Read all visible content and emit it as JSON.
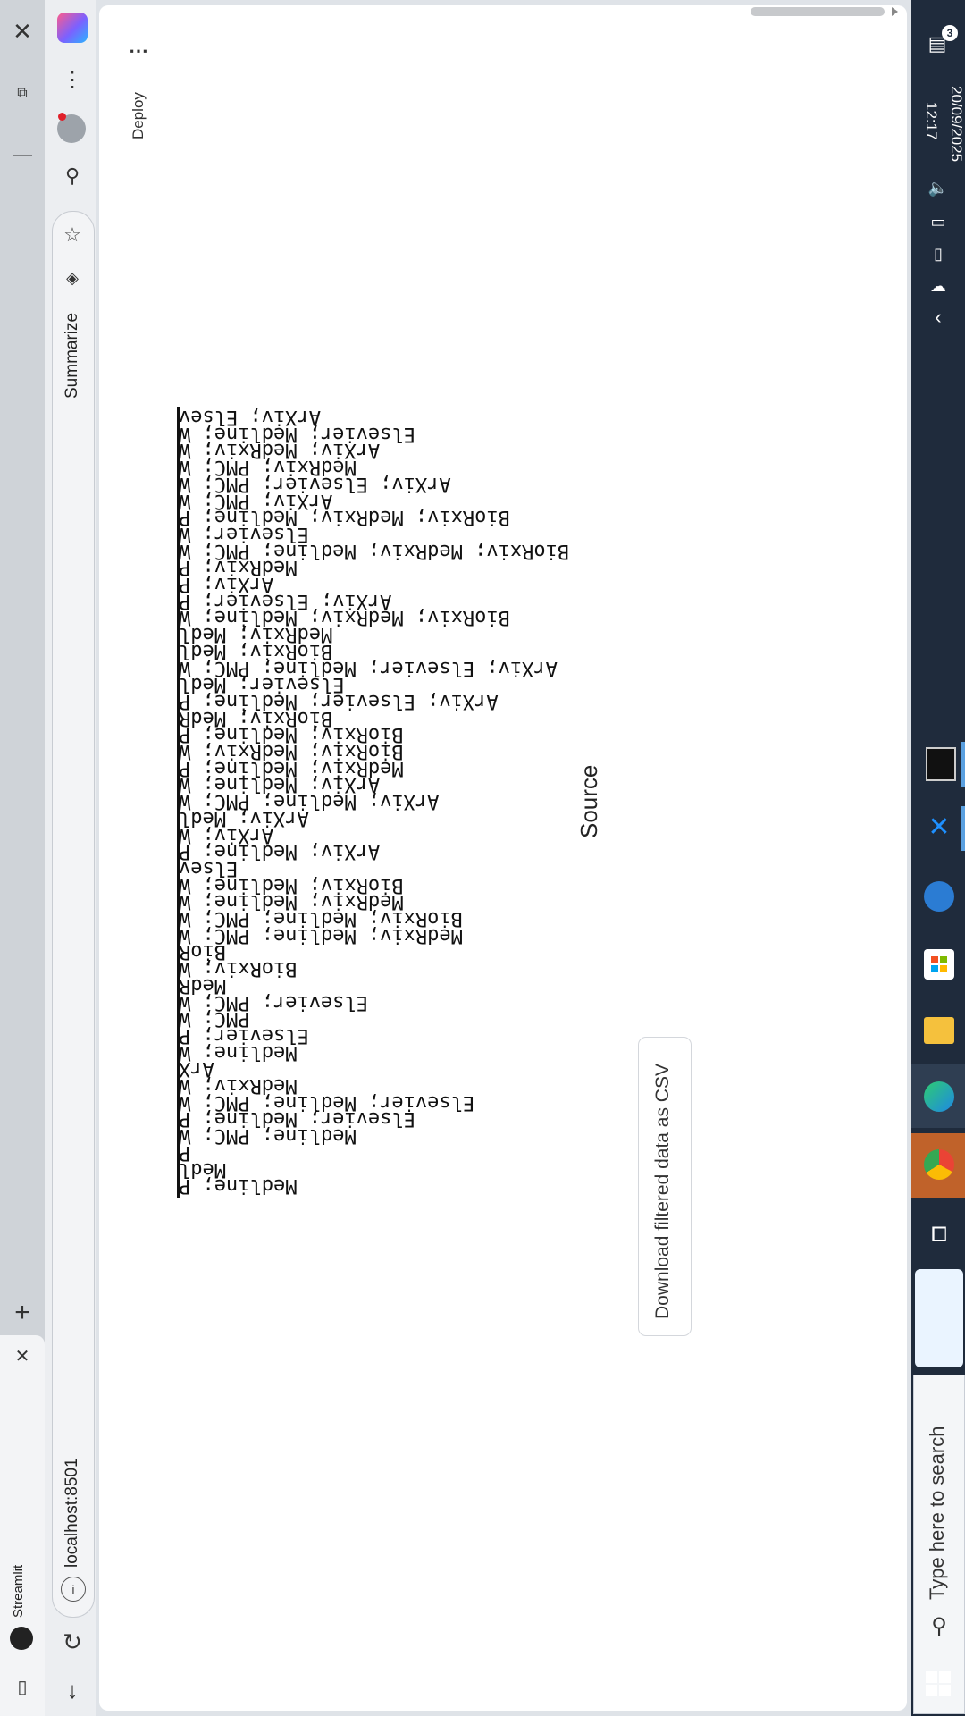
{
  "browser": {
    "tab_title": "Streamlit",
    "address": "localhost:8501",
    "summarize_label": "Summarize"
  },
  "app": {
    "deploy_label": "Deploy",
    "menu_label": "⋯",
    "download_button": "Download filtered data as CSV",
    "column_header": "Source",
    "source_rows": [
      "ArXiv; Elsev",
      "Elsevier; Medline; W",
      "ArXiv; MedRxiv; W",
      "MedRxiv; PMC; W",
      "ArXiv; Elsevier; PMC; W",
      "ArXiv; PMC; W",
      "BioRxiv; MedRxiv; Medline; P",
      "Elsevier; W",
      "BioRxiv; MedRxiv; Medline; PMC; W",
      "MedRxiv; P",
      "ArXiv; P",
      "ArXiv; Elsevier; P",
      "BioRxiv; MedRxiv; Medline; W",
      "MedRxiv; Medl",
      "BioRxiv; Medl",
      "ArXiv; Elsevier; Medline; PMC; W",
      "Elsevier; Medl",
      "ArXiv; Elsevier; Medline; P",
      "BioRxiv; MedR",
      "BioRxiv; Medline; P",
      "BioRxiv; MedRxiv; W",
      "MedRxiv; Medline; P",
      "ArXiv; Medline; W",
      "ArXiv; Medline; PMC; W",
      "ArXiv; Medl",
      "ArXiv; W",
      "ArXiv; Medline; P",
      "Elsev",
      "BioRxiv; Medline; W",
      "MedRxiv; Medline; W",
      "BioRxiv; Medline; PMC; W",
      "MedRxiv; Medline; PMC; W",
      "BioR",
      "BioRxiv; W",
      "MedR",
      "Elsevier; PMC; W",
      "PMC; W",
      "Elsevier; P",
      "Medline; W",
      "ArX",
      "MedRxiv; W",
      "Elsevier; Medline; PMC; W",
      "Elsevier; Medline; P",
      "Medline; PMC; W",
      "P",
      "Medl",
      "Medline; P"
    ]
  },
  "taskbar": {
    "time": "12:17",
    "date": "20/09/2025",
    "notification_count": "3",
    "search_placeholder": "Type here to search"
  }
}
